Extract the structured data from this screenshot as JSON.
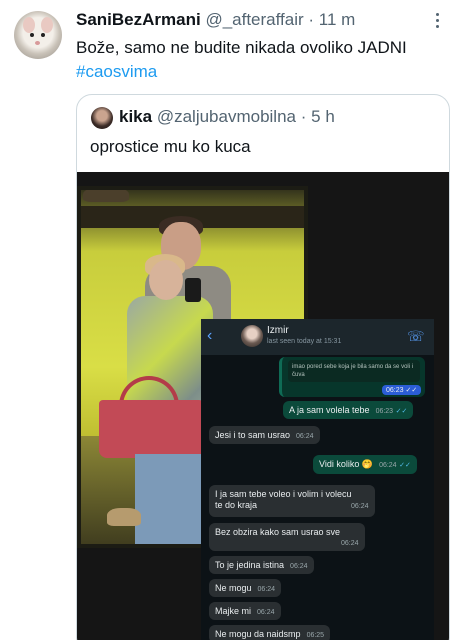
{
  "tweet": {
    "display_name": "SaniBezArmani",
    "handle": "@_afteraffair",
    "separator": "·",
    "time": "11 m",
    "text_main": "Bože, samo ne budite nikada ovoliko JADNI ",
    "hashtag": "#caosvima"
  },
  "quoted_tweet": {
    "display_name": "kika",
    "handle": "@zaljubavmobilna",
    "separator": "·",
    "time": "5 h",
    "text": "oprostice mu ko kuca"
  },
  "chat": {
    "contact_name": "Izmir",
    "last_seen": "last seen today at 15:31",
    "quoted_preview": "imao pored sebe koja je bila samo da se voli i čuva",
    "quoted_time": "06:23",
    "messages": [
      {
        "direction": "out",
        "text": "A ja sam volela tebe",
        "time": "06:23"
      },
      {
        "direction": "in",
        "text": "Jesi i to sam usrao",
        "time": "06:24"
      },
      {
        "direction": "out",
        "text": "Vidi koliko 🤭",
        "time": "06:24"
      },
      {
        "direction": "in",
        "text": "I ja sam tebe voleo i volim i volecu",
        "text2": "te do kraja",
        "time": "06:24"
      },
      {
        "direction": "in",
        "text": "Bez obzira kako sam usrao sve",
        "time": "06:24"
      },
      {
        "direction": "in",
        "text": "To je jedina istina",
        "time": "06:24"
      },
      {
        "direction": "in",
        "text": "Ne mogu",
        "time": "06:24"
      },
      {
        "direction": "in",
        "text": "Majke mi",
        "time": "06:24"
      },
      {
        "direction": "in",
        "text": "Ne mogu da naidsmp",
        "time": "06:25"
      }
    ],
    "read_ticks": "✓✓"
  },
  "icons": {
    "more": "more-dots-icon",
    "back": "chevron-left-icon",
    "call": "phone-add-icon"
  },
  "colors": {
    "link": "#1d9bf0",
    "secondary_text": "#536471",
    "chat_out_bubble": "#0b4a3b",
    "chat_in_bubble": "#2a2f32"
  }
}
